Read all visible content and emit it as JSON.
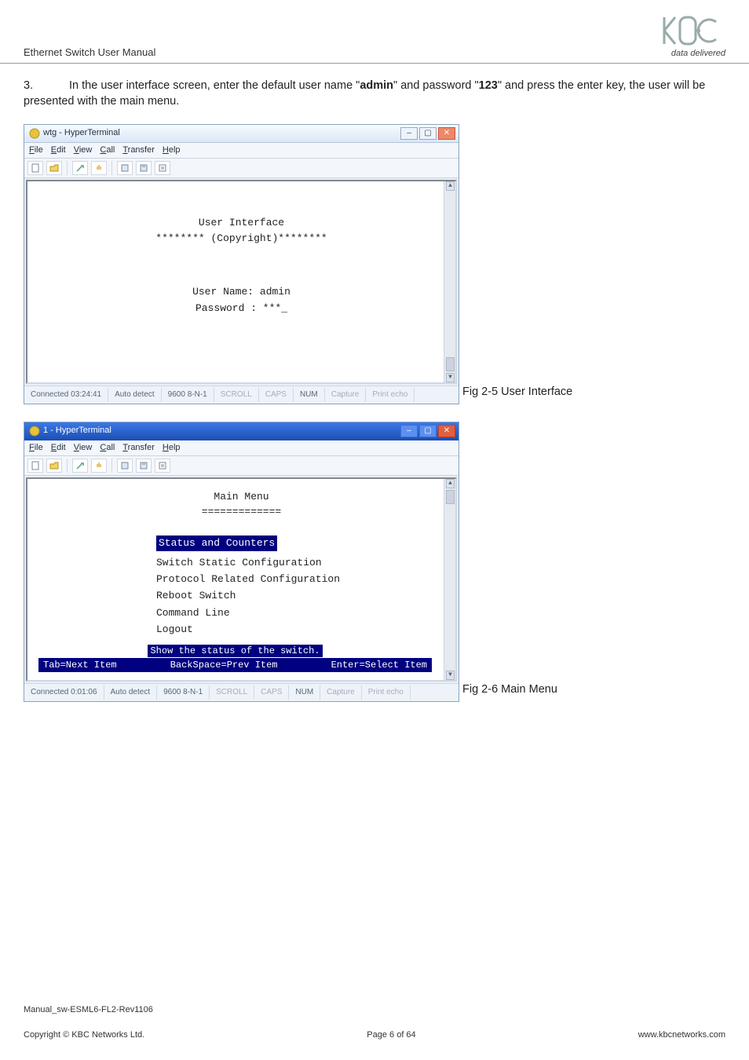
{
  "header": {
    "doc_title": "Ethernet Switch User Manual",
    "tagline": "data delivered"
  },
  "para": {
    "number": "3.",
    "before_admin": "In the user interface screen, enter the default user name \"",
    "admin": "admin",
    "after_admin": "\" and password \"",
    "pw": "123",
    "after_pw": "\" and press the enter key, the user will be presented with the main menu."
  },
  "win1": {
    "title": "wtg - HyperTerminal",
    "menus": {
      "file": "File",
      "edit": "Edit",
      "view": "View",
      "call": "Call",
      "transfer": "Transfer",
      "help": "Help"
    },
    "ui_head": "User Interface",
    "copyright": "******** (Copyright)********",
    "user_label": "User Name: admin",
    "pass_label": "Password : ***_",
    "status": {
      "conn": "Connected 03:24:41",
      "auto": "Auto detect",
      "baud": "9600 8-N-1",
      "scroll": "SCROLL",
      "caps": "CAPS",
      "num": "NUM",
      "capture": "Capture",
      "echo": "Print echo"
    }
  },
  "caption1": "Fig 2-5 User Interface",
  "win2": {
    "title": "1 - HyperTerminal",
    "menus": {
      "file": "File",
      "edit": "Edit",
      "view": "View",
      "call": "Call",
      "transfer": "Transfer",
      "help": "Help"
    },
    "main_head": "Main Menu",
    "rule": "=============",
    "items": {
      "i0": "Status and Counters",
      "i1": "Switch Static Configuration",
      "i2": "Protocol Related Configuration",
      "i3": "Reboot Switch",
      "i4": "Command Line",
      "i5": "Logout"
    },
    "hint_desc": "Show the status of the switch.",
    "hint_keys_left": "Tab=Next Item",
    "hint_keys_mid": "BackSpace=Prev Item",
    "hint_keys_right": "Enter=Select Item",
    "status": {
      "conn": "Connected 0:01:06",
      "auto": "Auto detect",
      "baud": "9600 8-N-1",
      "scroll": "SCROLL",
      "caps": "CAPS",
      "num": "NUM",
      "capture": "Capture",
      "echo": "Print echo"
    }
  },
  "caption2": "Fig 2-6 Main Menu",
  "footer": {
    "manual_id": "Manual_sw-ESML6-FL2-Rev1106",
    "copyright": "Copyright © KBC Networks Ltd.",
    "page": "Page 6 of 64",
    "url": "www.kbcnetworks.com"
  }
}
